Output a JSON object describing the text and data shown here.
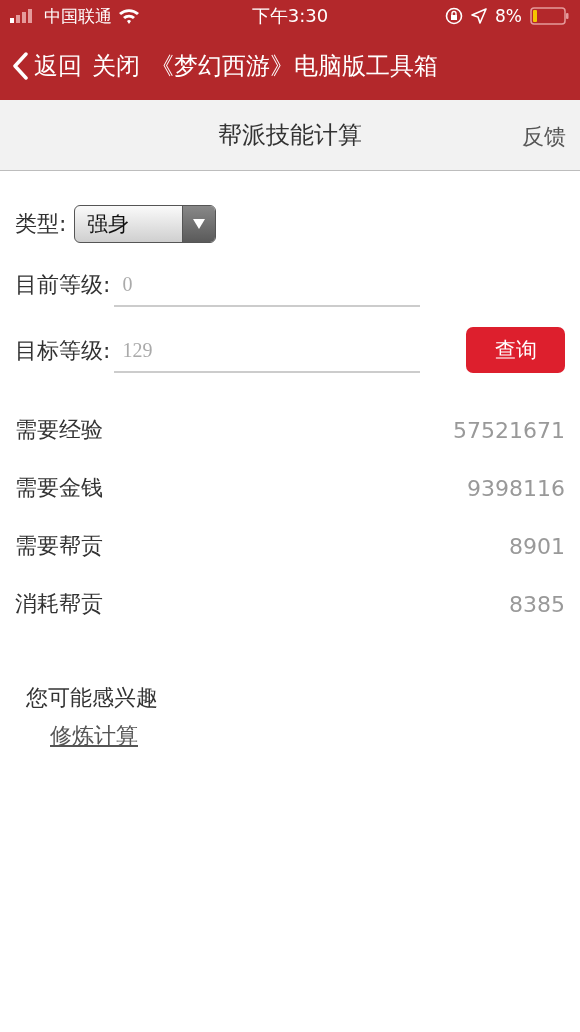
{
  "status_bar": {
    "carrier": "中国联通",
    "time": "下午3:30",
    "battery": "8%"
  },
  "nav": {
    "back": "返回",
    "close": "关闭",
    "title": "《梦幻西游》电脑版工具箱"
  },
  "header": {
    "title": "帮派技能计算",
    "action": "反馈"
  },
  "form": {
    "type_label": "类型:",
    "type_value": "强身",
    "fields": [
      {
        "label": "目前等级:",
        "placeholder": "0"
      },
      {
        "label": "目标等级:",
        "placeholder": "129"
      }
    ],
    "submit": "查询"
  },
  "results": [
    {
      "label": "需要经验",
      "value": "57521671"
    },
    {
      "label": "需要金钱",
      "value": "9398116"
    },
    {
      "label": "需要帮贡",
      "value": "8901"
    },
    {
      "label": "消耗帮贡",
      "value": "8385"
    }
  ],
  "related": {
    "title": "您可能感兴趣",
    "links": [
      "修炼计算"
    ]
  }
}
